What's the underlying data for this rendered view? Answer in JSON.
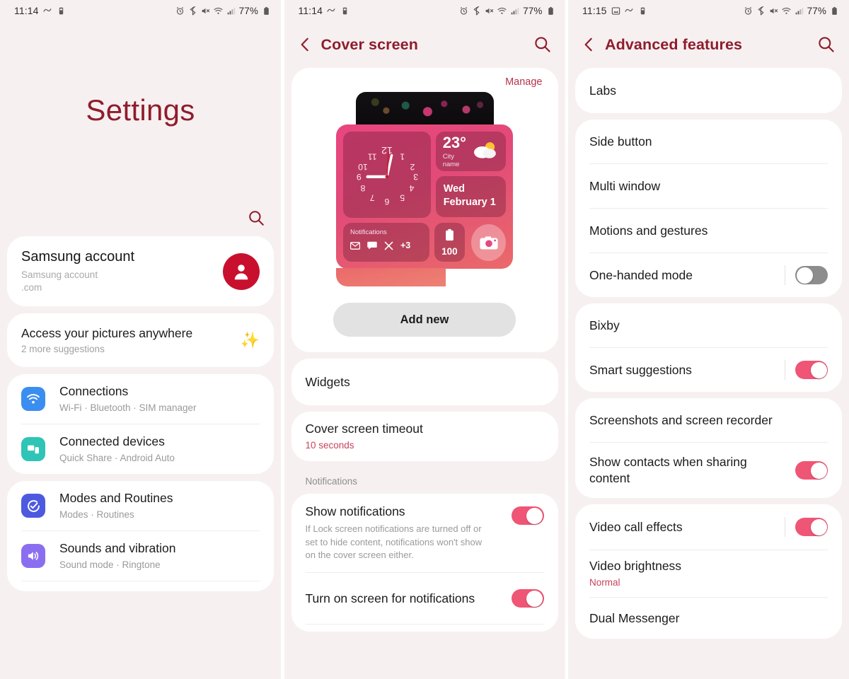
{
  "panels": {
    "left": {
      "statusbar": {
        "time": "11:14",
        "battery": "77%"
      },
      "title": "Settings",
      "account": {
        "name": "Samsung account",
        "sub_line1": "Samsung account",
        "sub_line2": ".com"
      },
      "suggestion": {
        "title": "Access your pictures anywhere",
        "sub": "2 more suggestions"
      },
      "items": [
        {
          "title": "Connections",
          "sub": "Wi-Fi  ·  Bluetooth  ·  SIM manager",
          "icon": "wifi-icon",
          "color": "#3b8ef0"
        },
        {
          "title": "Connected devices",
          "sub": "Quick Share  ·  Android Auto",
          "icon": "connected-devices-icon",
          "color": "#2ec4b6"
        },
        {
          "title": "Modes and Routines",
          "sub": "Modes  ·  Routines",
          "icon": "modes-routines-icon",
          "color": "#4d5ae0"
        },
        {
          "title": "Sounds and vibration",
          "sub": "Sound mode  ·  Ringtone",
          "icon": "sound-icon",
          "color": "#8b6ef0"
        }
      ]
    },
    "middle": {
      "statusbar": {
        "time": "11:14",
        "battery": "77%"
      },
      "title": "Cover screen",
      "manage_label": "Manage",
      "widget_preview": {
        "weather_temp": "23°",
        "weather_city": "City name",
        "date_line1": "Wed",
        "date_line2": "February 1",
        "notifications_label": "Notifications",
        "notifications_more": "+3",
        "battery_value": "100"
      },
      "add_new_label": "Add new",
      "widgets_label": "Widgets",
      "timeout": {
        "title": "Cover screen timeout",
        "value": "10 seconds"
      },
      "notifications_section_label": "Notifications",
      "show_notifications": {
        "title": "Show notifications",
        "desc": "If Lock screen notifications are turned off or set to hide content, notifications won't show on the cover screen either.",
        "state": "on"
      },
      "turn_on_screen": {
        "title": "Turn on screen for notifications",
        "state": "on"
      }
    },
    "right": {
      "statusbar": {
        "time": "11:15",
        "battery": "77%"
      },
      "title": "Advanced features",
      "groups": [
        {
          "rows": [
            {
              "title": "Labs",
              "toggle": "none"
            }
          ]
        },
        {
          "rows": [
            {
              "title": "Side button",
              "toggle": "none"
            },
            {
              "title": "Multi window",
              "toggle": "none"
            },
            {
              "title": "Motions and gestures",
              "toggle": "none"
            },
            {
              "title": "One-handed mode",
              "toggle": "off"
            }
          ]
        },
        {
          "rows": [
            {
              "title": "Bixby",
              "toggle": "none"
            },
            {
              "title": "Smart suggestions",
              "toggle": "on"
            }
          ]
        },
        {
          "rows": [
            {
              "title": "Screenshots and screen recorder",
              "toggle": "none"
            },
            {
              "title": "Show contacts when sharing content",
              "toggle": "on"
            }
          ]
        },
        {
          "rows": [
            {
              "title": "Video call effects",
              "toggle": "on"
            },
            {
              "title": "Video brightness",
              "sub": "Normal",
              "toggle": "none"
            },
            {
              "title": "Dual Messenger",
              "toggle": "none"
            }
          ]
        }
      ]
    }
  },
  "colors": {
    "accent": "#8e1d2c",
    "toggle_on": "#ef5575",
    "toggle_off": "#8d8d8d",
    "background": "#f7f0f1",
    "avatar": "#c8102e"
  }
}
